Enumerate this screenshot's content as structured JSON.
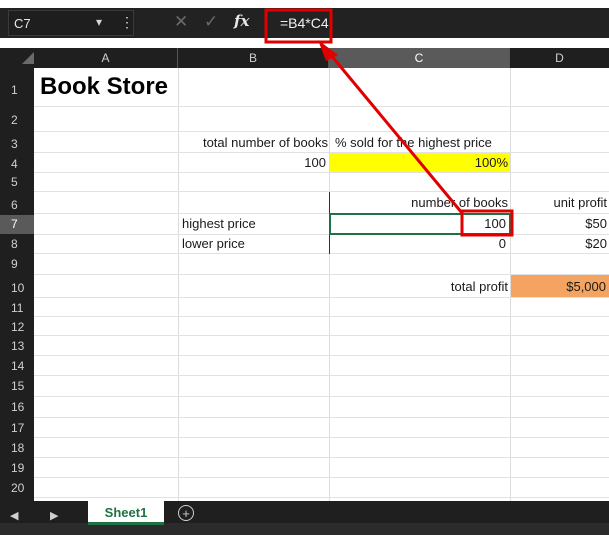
{
  "formula_bar": {
    "cell_ref": "C7",
    "formula": "=B4*C4",
    "fx_label": "fx"
  },
  "columns": [
    "A",
    "B",
    "C",
    "D"
  ],
  "rows": [
    "1",
    "2",
    "3",
    "4",
    "5",
    "6",
    "7",
    "8",
    "9",
    "10",
    "11",
    "12",
    "13",
    "14",
    "15",
    "16",
    "17",
    "18",
    "19",
    "20"
  ],
  "sheet": {
    "title": "Book Store",
    "b3": "total number of books",
    "c3": "% sold for the highest price",
    "b4": "100",
    "c4": "100%",
    "c6": "number of books",
    "d6": "unit profit",
    "b7": "highest price",
    "c7": "100",
    "d7": "$50",
    "b8": "lower price",
    "c8": "0",
    "d8": "$20",
    "c10": "total profit",
    "d10": "$5,000"
  },
  "tabs": {
    "sheet1": "Sheet1",
    "add": "+"
  },
  "colors": {
    "yellow_fill": "#ffff00",
    "orange_fill": "#f4a460",
    "annotation_red": "#e00000",
    "excel_green": "#1e7145"
  }
}
